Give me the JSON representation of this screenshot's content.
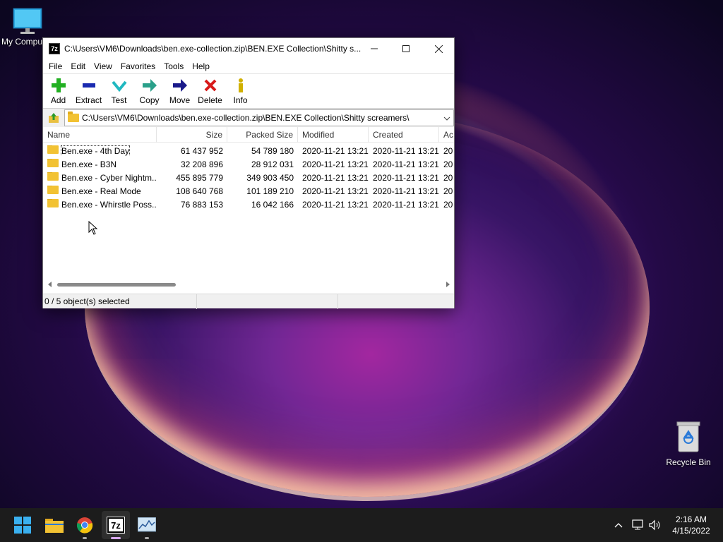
{
  "desktop": {
    "my_computer_label": "My Computer",
    "recycle_bin_label": "Recycle Bin"
  },
  "window": {
    "app_icon": "7z",
    "title": "C:\\Users\\VM6\\Downloads\\ben.exe-collection.zip\\BEN.EXE Collection\\Shitty s...",
    "menu": [
      "File",
      "Edit",
      "View",
      "Favorites",
      "Tools",
      "Help"
    ],
    "toolbar": [
      {
        "label": "Add",
        "icon": "add-icon",
        "glyph": "✚",
        "color": "#1aa31a"
      },
      {
        "label": "Extract",
        "icon": "extract-icon",
        "glyph": "▬",
        "color": "#1a2aa8"
      },
      {
        "label": "Test",
        "icon": "test-icon",
        "glyph": "▼",
        "color": "#1ab0b0"
      },
      {
        "label": "Copy",
        "icon": "copy-icon",
        "glyph": "➡",
        "color": "#1a9a7a"
      },
      {
        "label": "Move",
        "icon": "move-icon",
        "glyph": "➡",
        "color": "#1a1a8a"
      },
      {
        "label": "Delete",
        "icon": "delete-icon",
        "glyph": "✖",
        "color": "#d01a1a"
      },
      {
        "label": "Info",
        "icon": "info-icon",
        "glyph": "i",
        "color": "#c8a800"
      }
    ],
    "address": "C:\\Users\\VM6\\Downloads\\ben.exe-collection.zip\\BEN.EXE Collection\\Shitty screamers\\",
    "columns": [
      "Name",
      "Size",
      "Packed Size",
      "Modified",
      "Created",
      "Ac"
    ],
    "rows": [
      {
        "name": "Ben.exe - 4th Day",
        "size": "61 437 952",
        "packed": "54 789 180",
        "modified": "2020-11-21 13:21",
        "created": "2020-11-21 13:21",
        "ac": "20"
      },
      {
        "name": "Ben.exe - B3N",
        "size": "32 208 896",
        "packed": "28 912 031",
        "modified": "2020-11-21 13:21",
        "created": "2020-11-21 13:21",
        "ac": "20"
      },
      {
        "name": "Ben.exe - Cyber Nightm...",
        "size": "455 895 779",
        "packed": "349 903 450",
        "modified": "2020-11-21 13:21",
        "created": "2020-11-21 13:21",
        "ac": "20"
      },
      {
        "name": "Ben.exe - Real Mode",
        "size": "108 640 768",
        "packed": "101 189 210",
        "modified": "2020-11-21 13:21",
        "created": "2020-11-21 13:21",
        "ac": "20"
      },
      {
        "name": "Ben.exe - Whirstle Poss...",
        "size": "76 883 153",
        "packed": "16 042 166",
        "modified": "2020-11-21 13:21",
        "created": "2020-11-21 13:21",
        "ac": "20"
      }
    ],
    "status": "0 / 5 object(s) selected"
  },
  "taskbar": {
    "time": "2:16 AM",
    "date": "4/15/2022",
    "seven_zip_label": "7z"
  }
}
